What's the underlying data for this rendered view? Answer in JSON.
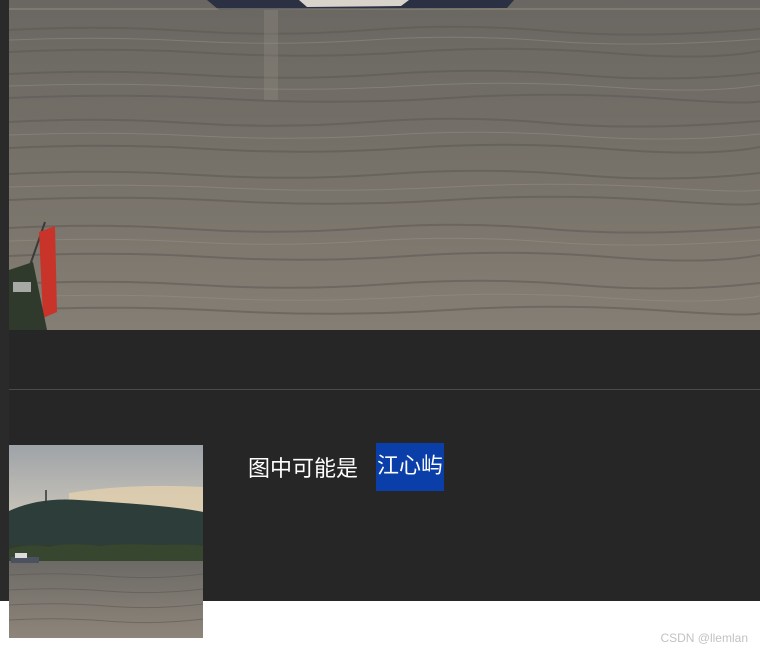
{
  "caption": {
    "prefix": "图中可能是",
    "tag": "江心屿"
  },
  "watermark": "CSDN @llemlan",
  "colors": {
    "panel_background": "#262626",
    "tag_background": "#0a3ea8",
    "caption_text": "#ffffff",
    "watermark_text": "#c2c2c2"
  },
  "images": {
    "top_photo": "river-water-photo",
    "thumbnail": "river-island-photo"
  }
}
